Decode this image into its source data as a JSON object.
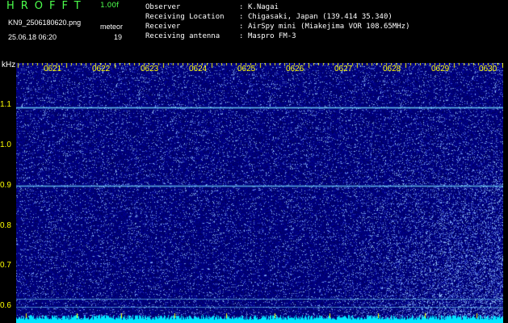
{
  "header": {
    "app_title": "HROFFT",
    "version": "1.00f",
    "filename": "KN9_2506180620.png",
    "meteor_label": "meteor",
    "timestamp": "25.06.18 06:20",
    "meteor_count": "19"
  },
  "info": [
    {
      "key": "Observer",
      "value": "K.Nagai"
    },
    {
      "key": "Receiving Location",
      "value": "Chigasaki, Japan (139.414 35.340)"
    },
    {
      "key": "Receiver",
      "value": "AirSpy mini (Miakejima VOR 108.65MHz)"
    },
    {
      "key": "Receiving antenna",
      "value": "Maspro FM-3"
    }
  ],
  "info_separator": ":",
  "axis": {
    "unit": "kHz",
    "y_ticks": [
      "1.1",
      "1.0",
      "0.9",
      "0.8",
      "0.7",
      "0.6"
    ],
    "x_ticks": [
      "0621",
      "0622",
      "0623",
      "0624",
      "0625",
      "0626",
      "0627",
      "0628",
      "0629",
      "0630"
    ]
  },
  "colors": {
    "background": "#000000",
    "spectrogram_bg": "#00007a",
    "tick_label": "#ffff00",
    "title": "#4cff4c",
    "signal_line": "#6fd8ff",
    "noise_floor": "#00e5ff"
  }
}
